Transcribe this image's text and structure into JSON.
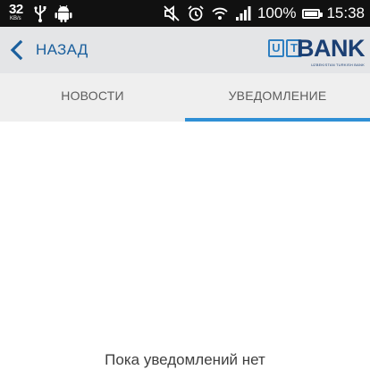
{
  "colors": {
    "statusbar_bg": "#111111",
    "appbar_bg": "#e4e5e7",
    "back_blue": "#1a5f9d",
    "tab_bg": "#efefef",
    "tab_active_indicator": "#2f8fd5",
    "brand_dark": "#1b3f73",
    "brand_light": "#2e7fc1"
  },
  "status_bar": {
    "temperature": "32",
    "temperature_unit": "KB/s",
    "battery_percent": "100%",
    "battery_level": 1.0,
    "time": "15:38",
    "icons": [
      "usb-icon",
      "android-icon",
      "mute-icon",
      "alarm-icon",
      "wifi-icon",
      "signal-icon",
      "battery-icon"
    ]
  },
  "app_bar": {
    "back_label": "НАЗАД",
    "logo": {
      "prefix": "UT",
      "name": "BANK",
      "tagline": "UZBEKISTAN TURKISH BANK"
    }
  },
  "tabs": [
    {
      "label": "НОВОСТИ",
      "active": false
    },
    {
      "label": "УВЕДОМЛЕНИЕ",
      "active": true
    }
  ],
  "content": {
    "empty_message": "Пока уведомлений нет"
  }
}
